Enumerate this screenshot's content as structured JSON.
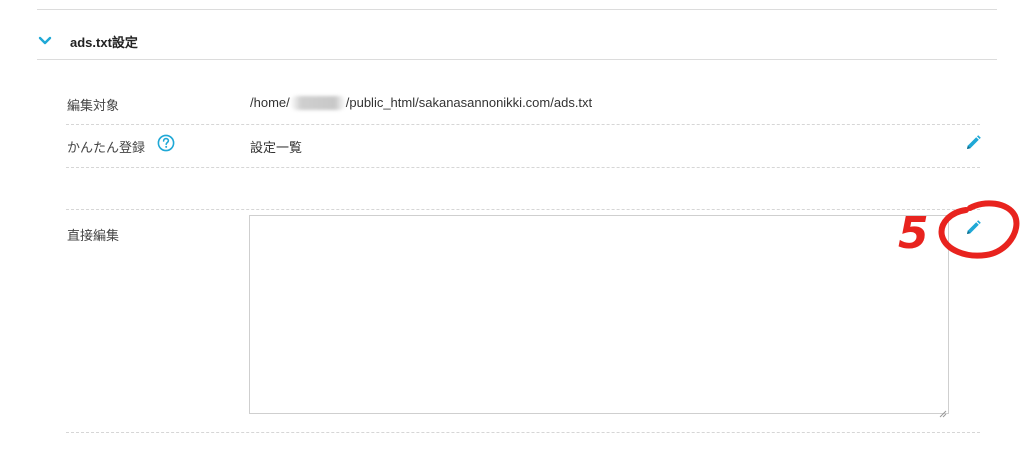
{
  "section": {
    "title": "ads.txt設定",
    "toggle_icon": "chevron-down-icon"
  },
  "rows": {
    "target": {
      "label": "編集対象",
      "path_prefix": "/home/",
      "path_suffix": "/public_html/sakanasannonikki.com/ads.txt"
    },
    "easy": {
      "label": "かんたん登録",
      "help_icon": "question-circle-icon",
      "value": "設定一覧",
      "edit_icon": "pencil-icon"
    },
    "direct": {
      "label": "直接編集",
      "textarea_value": "",
      "edit_icon": "pencil-icon"
    }
  },
  "annotation": {
    "text": "5",
    "color": "#e8231e"
  },
  "colors": {
    "accent": "#1fa8d6",
    "divider": "#d6d6d6"
  }
}
